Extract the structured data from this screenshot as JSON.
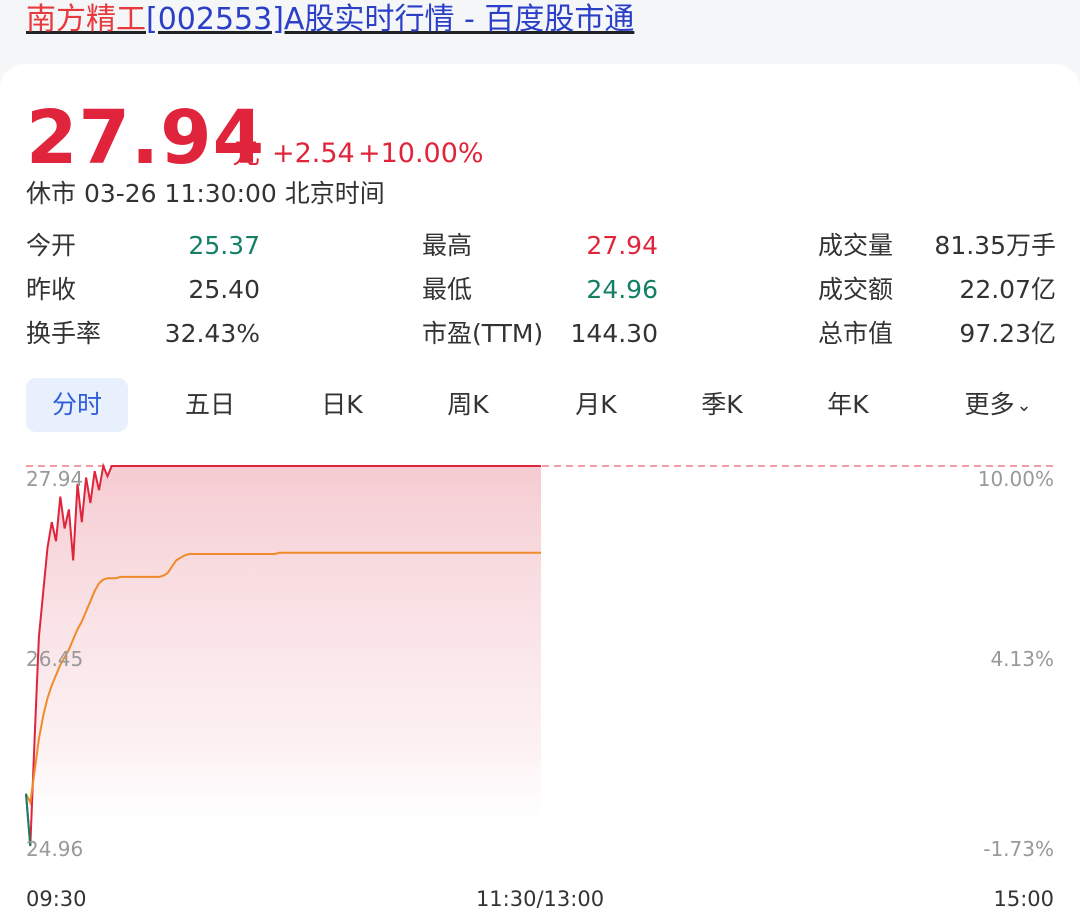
{
  "page_title": {
    "name": "南方精工",
    "rest": "[002553]A股实时行情 - 百度股市通"
  },
  "quote": {
    "price": "27.94",
    "unit": "元",
    "change": "+2.54",
    "change_pct": "+10.00%",
    "status": "休市 03-26 11:30:00 北京时间"
  },
  "stats": {
    "col1": [
      {
        "label": "今开",
        "value": "25.37",
        "color": "green"
      },
      {
        "label": "昨收",
        "value": "25.40",
        "color": "dark"
      },
      {
        "label": "换手率",
        "value": "32.43%",
        "color": "dark"
      }
    ],
    "col2": [
      {
        "label": "最高",
        "value": "27.94",
        "color": "red"
      },
      {
        "label": "最低",
        "value": "24.96",
        "color": "green"
      },
      {
        "label": "市盈(TTM)",
        "value": "144.30",
        "color": "dark"
      }
    ],
    "col3": [
      {
        "label": "成交量",
        "value": "81.35万手",
        "color": "dark"
      },
      {
        "label": "成交额",
        "value": "22.07亿",
        "color": "dark"
      },
      {
        "label": "总市值",
        "value": "97.23亿",
        "color": "dark"
      }
    ]
  },
  "tabs": [
    "分时",
    "五日",
    "日K",
    "周K",
    "月K",
    "季K",
    "年K",
    "更多"
  ],
  "active_tab": "分时",
  "colors": {
    "up": "#e0243b",
    "down": "#138066",
    "avg_line": "#f08a2b",
    "active_tab_bg": "#e9f0fd",
    "active_tab_text": "#2f5ed8"
  },
  "chart_data": {
    "type": "line",
    "y_left_ticks": [
      "27.94",
      "26.45",
      "24.96"
    ],
    "y_right_ticks": [
      "10.00%",
      "4.13%",
      "-1.73%"
    ],
    "x_ticks": [
      "09:30",
      "11:30/13:00",
      "15:00"
    ],
    "ylim": [
      24.96,
      27.94
    ],
    "reference_price": 25.4,
    "series": [
      {
        "values": [
          25.37,
          24.96,
          25.8,
          26.6,
          26.95,
          27.3,
          27.5,
          27.35,
          27.7,
          27.45,
          27.6,
          27.2,
          27.8,
          27.5,
          27.85,
          27.65,
          27.9,
          27.75,
          27.94,
          27.86,
          27.94,
          27.94,
          27.94,
          27.94,
          27.94,
          27.94,
          27.94,
          27.94,
          27.94,
          27.94,
          27.94,
          27.94,
          27.94,
          27.94,
          27.94,
          27.94,
          27.94,
          27.94,
          27.94,
          27.94,
          27.94,
          27.94,
          27.94,
          27.94,
          27.94,
          27.94,
          27.94,
          27.94,
          27.94,
          27.94,
          27.94,
          27.94,
          27.94,
          27.94,
          27.94,
          27.94,
          27.94,
          27.94,
          27.94,
          27.94,
          27.94,
          27.94,
          27.94,
          27.94,
          27.94,
          27.94,
          27.94,
          27.94,
          27.94,
          27.94,
          27.94,
          27.94,
          27.94,
          27.94,
          27.94,
          27.94,
          27.94,
          27.94,
          27.94,
          27.94,
          27.94,
          27.94,
          27.94,
          27.94,
          27.94,
          27.94,
          27.94,
          27.94,
          27.94,
          27.94,
          27.94,
          27.94,
          27.94,
          27.94,
          27.94,
          27.94,
          27.94,
          27.94,
          27.94,
          27.94,
          27.94,
          27.94,
          27.94,
          27.94,
          27.94,
          27.94,
          27.94,
          27.94,
          27.94,
          27.94,
          27.94,
          27.94,
          27.94,
          27.94,
          27.94,
          27.94,
          27.94,
          27.94,
          27.94,
          27.94,
          27.94
        ],
        "color": "#e0243b"
      },
      {
        "values": [
          25.37,
          25.3,
          25.55,
          25.8,
          25.98,
          26.12,
          26.22,
          26.3,
          26.38,
          26.44,
          26.5,
          26.58,
          26.66,
          26.72,
          26.8,
          26.88,
          26.96,
          27.02,
          27.05,
          27.06,
          27.06,
          27.06,
          27.07,
          27.07,
          27.07,
          27.07,
          27.07,
          27.07,
          27.07,
          27.07,
          27.07,
          27.07,
          27.08,
          27.1,
          27.15,
          27.2,
          27.22,
          27.24,
          27.25,
          27.25,
          27.25,
          27.25,
          27.25,
          27.25,
          27.25,
          27.25,
          27.25,
          27.25,
          27.25,
          27.25,
          27.25,
          27.25,
          27.25,
          27.25,
          27.25,
          27.25,
          27.25,
          27.25,
          27.25,
          27.26,
          27.26,
          27.26,
          27.26,
          27.26,
          27.26,
          27.26,
          27.26,
          27.26,
          27.26,
          27.26,
          27.26,
          27.26,
          27.26,
          27.26,
          27.26,
          27.26,
          27.26,
          27.26,
          27.26,
          27.26,
          27.26,
          27.26,
          27.26,
          27.26,
          27.26,
          27.26,
          27.26,
          27.26,
          27.26,
          27.26,
          27.26,
          27.26,
          27.26,
          27.26,
          27.26,
          27.26,
          27.26,
          27.26,
          27.26,
          27.26,
          27.26,
          27.26,
          27.26,
          27.26,
          27.26,
          27.26,
          27.26,
          27.26,
          27.26,
          27.26,
          27.26,
          27.26,
          27.26,
          27.26,
          27.26,
          27.26,
          27.26,
          27.26,
          27.26,
          27.26,
          27.26
        ],
        "color": "#f08a2b"
      }
    ],
    "points_total_session": 241
  }
}
